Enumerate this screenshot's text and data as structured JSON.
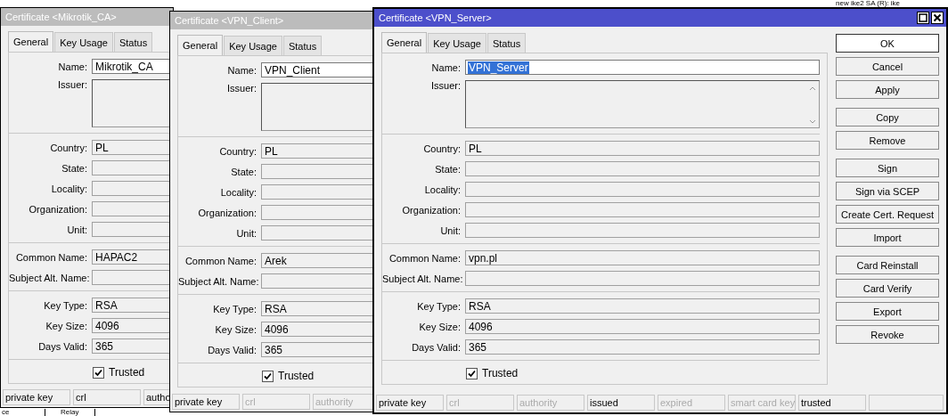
{
  "background_items": [
    {
      "text": "new ike2 SA (R): ike"
    },
    {
      "text": "ce"
    },
    {
      "text": "Relay"
    }
  ],
  "windows": [
    {
      "title": "Certificate <Mikrotik_CA>",
      "active": false,
      "tabs": [
        {
          "label": "General",
          "selected": true
        },
        {
          "label": "Key Usage",
          "selected": false
        },
        {
          "label": "Status",
          "selected": false
        }
      ],
      "sections": [
        [
          {
            "label": "Name:",
            "kind": "text",
            "value": "Mikrotik_CA",
            "highlighted": false
          },
          {
            "label": "Issuer:",
            "kind": "area"
          }
        ],
        [
          {
            "label": "Country:",
            "kind": "readonly",
            "value": "PL"
          },
          {
            "label": "State:",
            "kind": "readonly"
          },
          {
            "label": "Locality:",
            "kind": "readonly"
          },
          {
            "label": "Organization:",
            "kind": "readonly"
          },
          {
            "label": "Unit:",
            "kind": "readonly"
          }
        ],
        [
          {
            "label": "Common Name:",
            "kind": "readonly",
            "value": "HAPAC2"
          },
          {
            "label": "Subject Alt. Name:",
            "kind": "readonly"
          }
        ],
        [
          {
            "label": "Key Type:",
            "kind": "readonly",
            "value": "RSA"
          },
          {
            "label": "Key Size:",
            "kind": "readonly",
            "value": "4096"
          },
          {
            "label": "Days Valid:",
            "kind": "readonly",
            "value": "365"
          }
        ]
      ],
      "trusted": {
        "label": "Trusted",
        "checked": true
      },
      "status_items": [
        {
          "label": "private key",
          "enabled": true
        },
        {
          "label": "crl",
          "enabled": true
        },
        {
          "label": "autho",
          "enabled": true
        }
      ]
    },
    {
      "title": "Certificate <VPN_Client>",
      "active": false,
      "tabs": [
        {
          "label": "General",
          "selected": true
        },
        {
          "label": "Key Usage",
          "selected": false
        },
        {
          "label": "Status",
          "selected": false
        }
      ],
      "sections": [
        [
          {
            "label": "Name:",
            "kind": "text",
            "value": "VPN_Client",
            "highlighted": false
          },
          {
            "label": "Issuer:",
            "kind": "area"
          }
        ],
        [
          {
            "label": "Country:",
            "kind": "readonly",
            "value": "PL"
          },
          {
            "label": "State:",
            "kind": "readonly"
          },
          {
            "label": "Locality:",
            "kind": "readonly"
          },
          {
            "label": "Organization:",
            "kind": "readonly"
          },
          {
            "label": "Unit:",
            "kind": "readonly"
          }
        ],
        [
          {
            "label": "Common Name:",
            "kind": "readonly",
            "value": "Arek"
          },
          {
            "label": "Subject Alt. Name:",
            "kind": "readonly"
          }
        ],
        [
          {
            "label": "Key Type:",
            "kind": "readonly",
            "value": "RSA"
          },
          {
            "label": "Key Size:",
            "kind": "readonly",
            "value": "4096"
          },
          {
            "label": "Days Valid:",
            "kind": "readonly",
            "value": "365"
          }
        ]
      ],
      "trusted": {
        "label": "Trusted",
        "checked": true
      },
      "status_items": [
        {
          "label": "private key",
          "enabled": true
        },
        {
          "label": "crl",
          "enabled": false
        },
        {
          "label": "authority",
          "enabled": false
        }
      ]
    },
    {
      "title": "Certificate <VPN_Server>",
      "active": true,
      "tabs": [
        {
          "label": "General",
          "selected": true
        },
        {
          "label": "Key Usage",
          "selected": false
        },
        {
          "label": "Status",
          "selected": false
        }
      ],
      "sections": [
        [
          {
            "label": "Name:",
            "kind": "text",
            "value": "VPN_Server",
            "highlighted": true
          },
          {
            "label": "Issuer:",
            "kind": "area"
          }
        ],
        [
          {
            "label": "Country:",
            "kind": "readonly",
            "value": "PL"
          },
          {
            "label": "State:",
            "kind": "readonly"
          },
          {
            "label": "Locality:",
            "kind": "readonly"
          },
          {
            "label": "Organization:",
            "kind": "readonly"
          },
          {
            "label": "Unit:",
            "kind": "readonly"
          }
        ],
        [
          {
            "label": "Common Name:",
            "kind": "readonly",
            "value": "vpn.pl"
          },
          {
            "label": "Subject Alt. Name:",
            "kind": "readonly"
          }
        ],
        [
          {
            "label": "Key Type:",
            "kind": "readonly",
            "value": "RSA"
          },
          {
            "label": "Key Size:",
            "kind": "readonly",
            "value": "4096"
          },
          {
            "label": "Days Valid:",
            "kind": "readonly",
            "value": "365"
          }
        ]
      ],
      "trusted": {
        "label": "Trusted",
        "checked": true
      },
      "button_groups": [
        [
          {
            "label": "OK",
            "default": true
          },
          {
            "label": "Cancel",
            "default": false
          },
          {
            "label": "Apply",
            "default": false
          }
        ],
        [
          {
            "label": "Copy",
            "default": false
          },
          {
            "label": "Remove",
            "default": false
          }
        ],
        [
          {
            "label": "Sign",
            "default": false
          },
          {
            "label": "Sign via SCEP",
            "default": false
          },
          {
            "label": "Create Cert. Request",
            "default": false
          },
          {
            "label": "Import",
            "default": false
          }
        ],
        [
          {
            "label": "Card Reinstall",
            "default": false
          },
          {
            "label": "Card Verify",
            "default": false
          },
          {
            "label": "Export",
            "default": false
          },
          {
            "label": "Revoke",
            "default": false
          }
        ]
      ],
      "status_items": [
        {
          "label": "private key",
          "enabled": true
        },
        {
          "label": "crl",
          "enabled": false
        },
        {
          "label": "authority",
          "enabled": false
        },
        {
          "label": "issued",
          "enabled": true
        },
        {
          "label": "expired",
          "enabled": false
        },
        {
          "label": "smart card key",
          "enabled": false
        },
        {
          "label": "trusted",
          "enabled": true
        }
      ]
    }
  ]
}
